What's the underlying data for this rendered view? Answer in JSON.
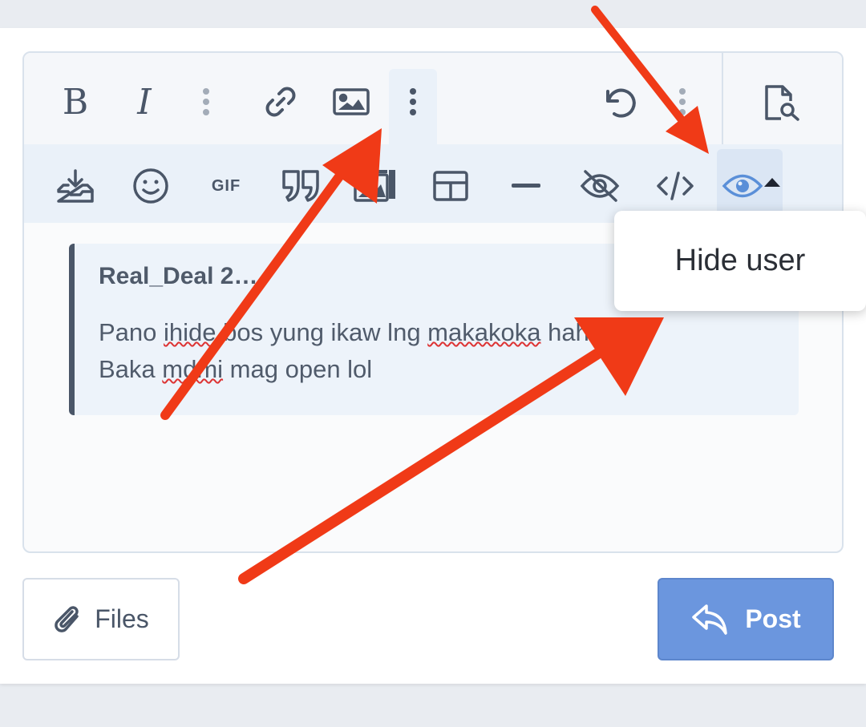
{
  "toolbar": {
    "row1": [
      {
        "name": "bold-button",
        "icon": "bold-icon",
        "label": "B"
      },
      {
        "name": "italic-button",
        "icon": "italic-icon",
        "label": "I"
      },
      {
        "name": "more-text-button",
        "icon": "vertical-ellipsis-icon"
      },
      {
        "name": "link-button",
        "icon": "link-icon"
      },
      {
        "name": "image-button",
        "icon": "image-icon"
      },
      {
        "name": "more-insert-button",
        "icon": "vertical-ellipsis-icon"
      },
      {
        "name": "undo-button",
        "icon": "undo-icon"
      },
      {
        "name": "more-options-button",
        "icon": "vertical-ellipsis-icon"
      },
      {
        "name": "preview-button",
        "icon": "document-search-icon"
      }
    ],
    "row2": [
      {
        "name": "drafts-button",
        "icon": "tray-download-icon"
      },
      {
        "name": "emoji-button",
        "icon": "smiley-icon"
      },
      {
        "name": "gif-button",
        "icon": "gif-icon",
        "label": "GIF"
      },
      {
        "name": "quote-button",
        "icon": "quote-icon"
      },
      {
        "name": "media-button",
        "icon": "media-gallery-icon"
      },
      {
        "name": "table-button",
        "icon": "table-icon"
      },
      {
        "name": "horizontal-line-button",
        "icon": "minus-icon"
      },
      {
        "name": "spoiler-button",
        "icon": "eye-slash-icon"
      },
      {
        "name": "code-button",
        "icon": "code-icon"
      },
      {
        "name": "hide-button",
        "icon": "eye-icon"
      }
    ]
  },
  "quote": {
    "author": "Real_Deal 2…",
    "line1_a": "Pano ",
    "line1_b": "ihide",
    "line1_c": " bos yung ikaw lng ",
    "line1_d": "makakoka",
    "line1_e": " haha.",
    "line2_a": "Baka ",
    "line2_b": "mdmi",
    "line2_c": " mag open lol"
  },
  "hide_menu": {
    "item_label": "Hide user"
  },
  "actions": {
    "files_label": "Files",
    "post_label": "Post"
  },
  "colors": {
    "accent": "#6b96de",
    "active_icon": "#5a8fd8",
    "annotation_arrow": "#f03a17",
    "icon": "#4a5668"
  }
}
